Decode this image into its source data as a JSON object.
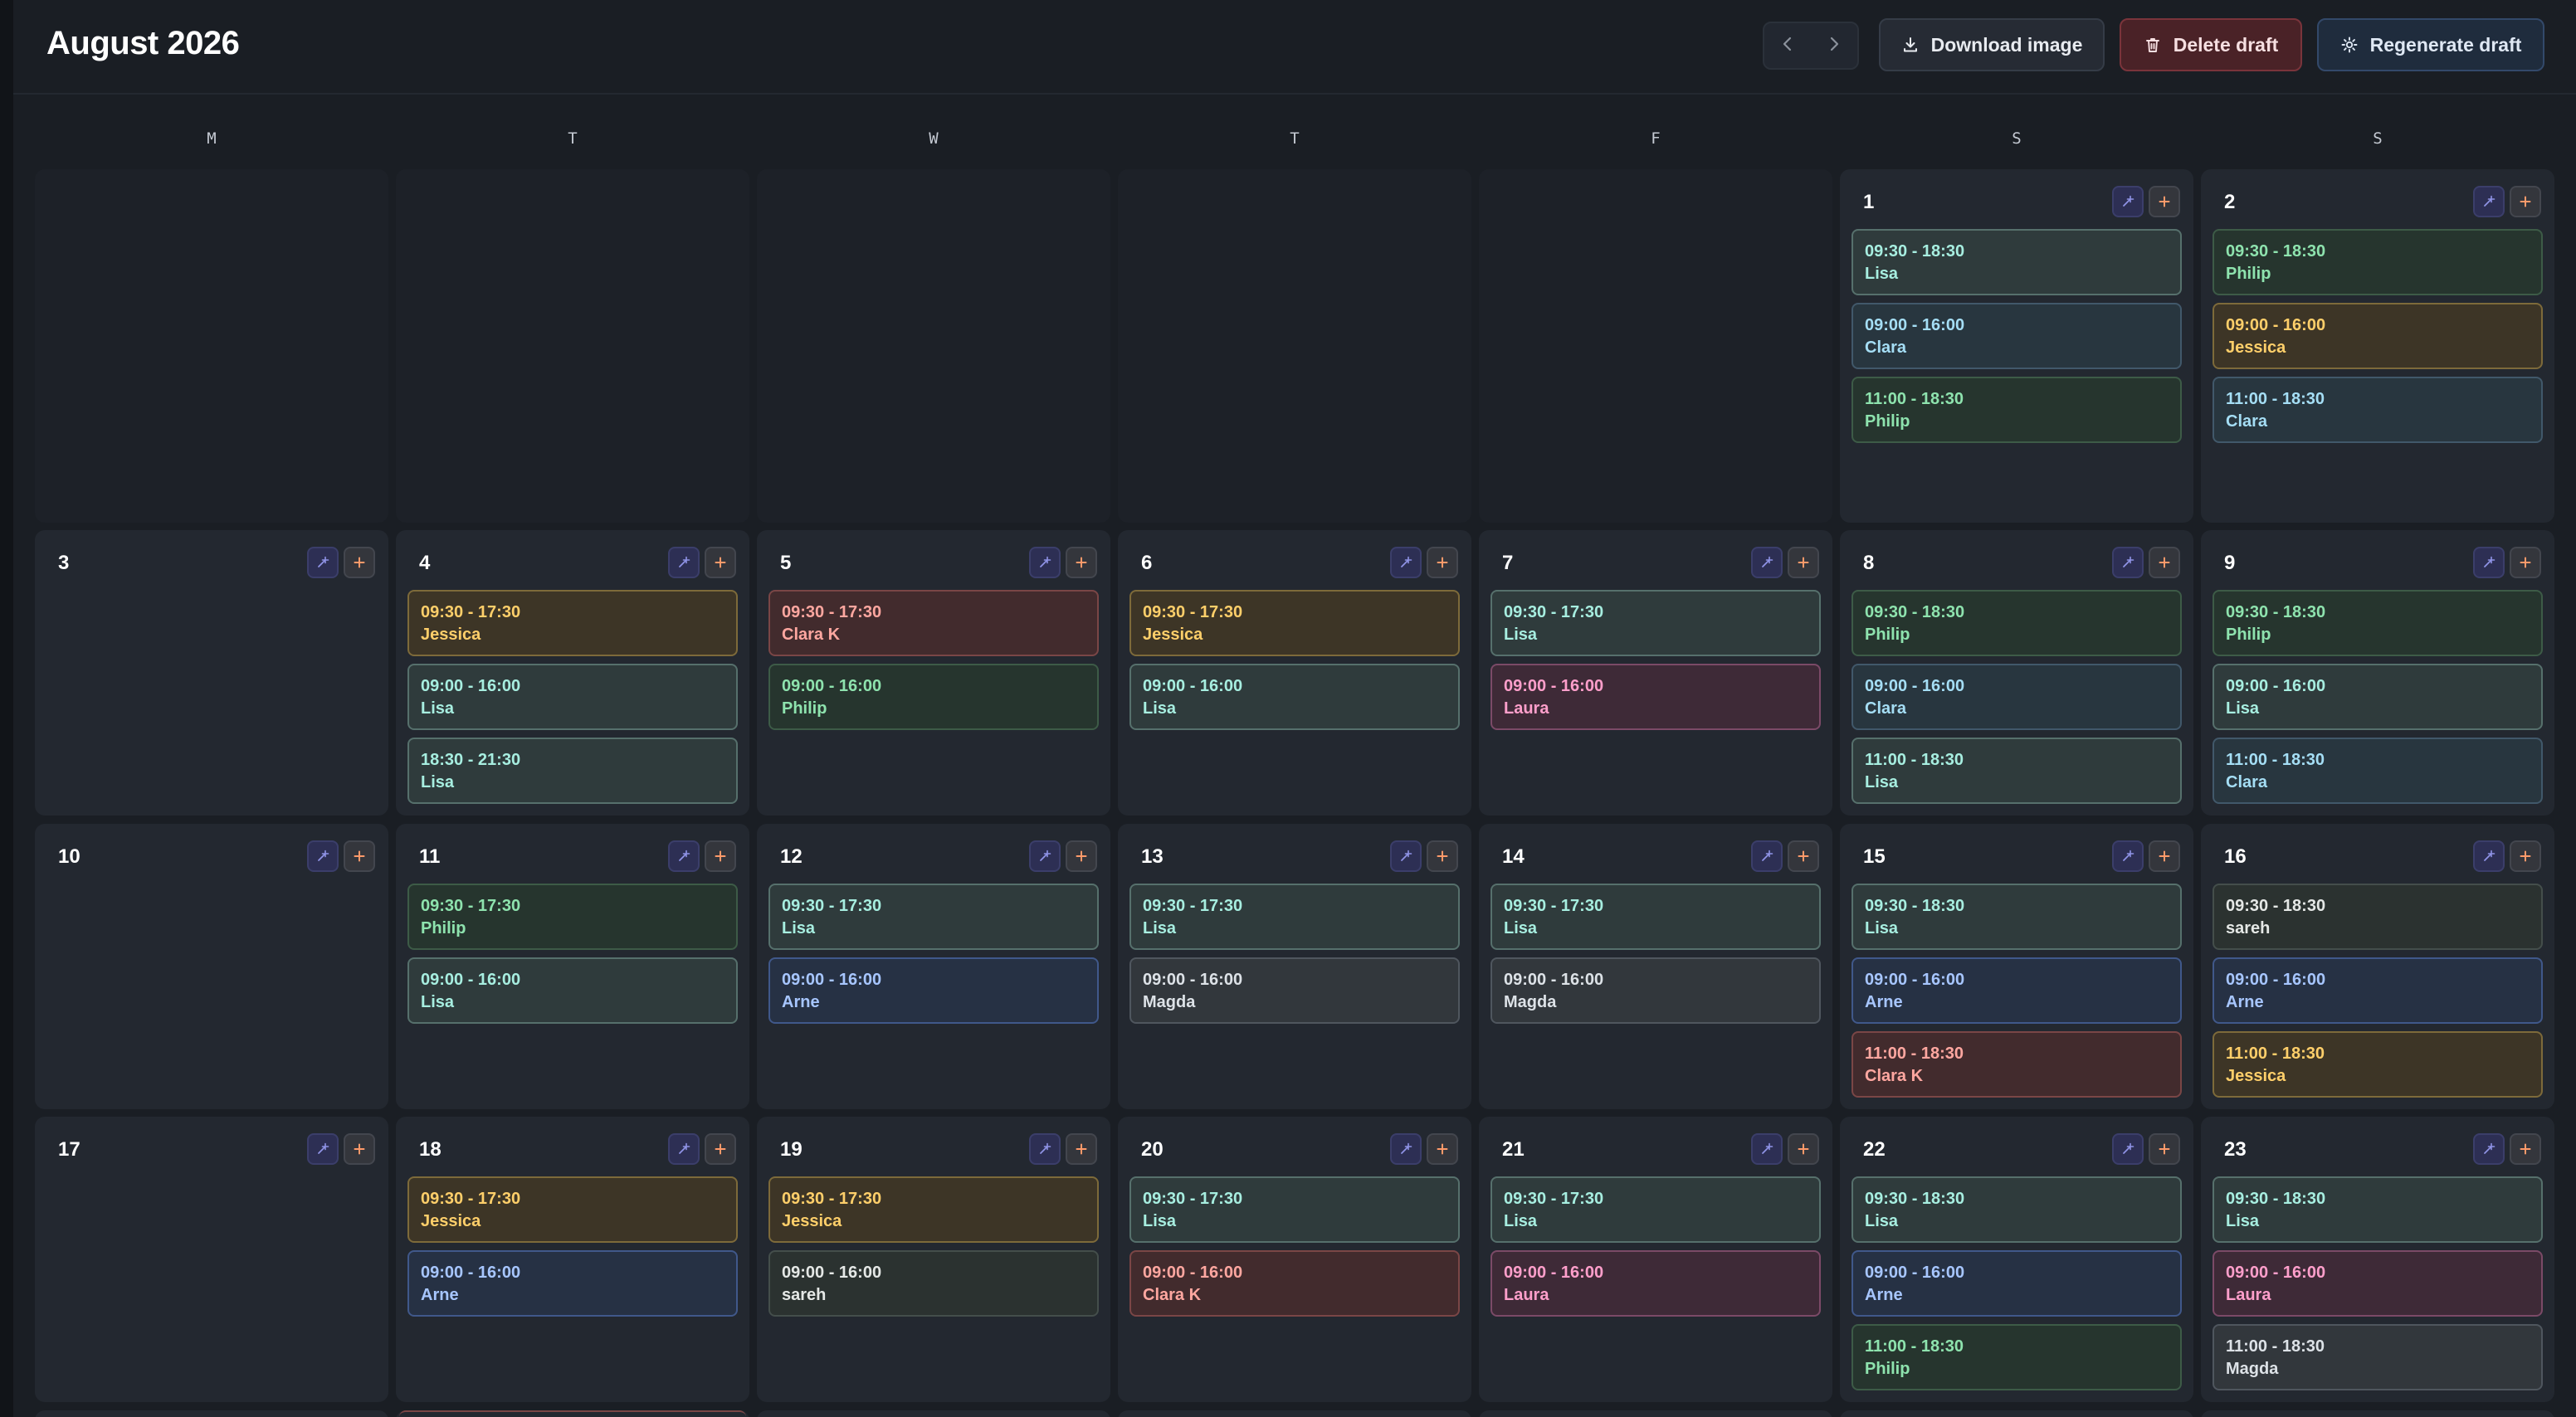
{
  "header": {
    "title": "August 2026",
    "download_label": "Download image",
    "delete_label": "Delete draft",
    "regenerate_label": "Regenerate draft",
    "icons": {
      "prev": "chevron-left-icon",
      "next": "chevron-right-icon",
      "download": "download-icon",
      "delete": "trash-icon",
      "regenerate": "sparkle-icon"
    }
  },
  "weekdays": [
    "M",
    "T",
    "W",
    "T",
    "F",
    "S",
    "S"
  ],
  "cell_icons": {
    "auto_fill": "wand-icon",
    "add": "plus-icon"
  },
  "colors": {
    "lisa": {
      "bg": "#2f3b3c",
      "border": "#56706c",
      "text": "#a7eee0",
      "name": "#a7eee0"
    },
    "clara": {
      "bg": "#28363f",
      "border": "#41586a",
      "text": "#a5def5",
      "name": "#a5def5"
    },
    "philip": {
      "bg": "#26352e",
      "border": "#3d5b47",
      "text": "#8ee3ae",
      "name": "#8ee3ae"
    },
    "jessica": {
      "bg": "#3d3526",
      "border": "#7d6a3a",
      "text": "#ffcf6a",
      "name": "#ffcf6a"
    },
    "clarak": {
      "bg": "#422b2d",
      "border": "#7a4646",
      "text": "#ffa7a0",
      "name": "#ffa7a0"
    },
    "laura": {
      "bg": "#3e2a37",
      "border": "#7b4a67",
      "text": "#ff9fcb",
      "name": "#ff9fcb"
    },
    "arne": {
      "bg": "#263144",
      "border": "#40588a",
      "text": "#a7c6ff",
      "name": "#a7c6ff"
    },
    "magda": {
      "bg": "#32373c",
      "border": "#4f565e",
      "text": "#dde2e7",
      "name": "#dde2e7"
    },
    "sareh": {
      "bg": "#2b3230",
      "border": "#444e4b",
      "text": "#e5e8e6",
      "name": "#e5e8e6"
    }
  },
  "days": [
    {
      "num": "1",
      "row": 0,
      "col": 5,
      "shifts": [
        {
          "time": "09:30 - 18:30",
          "name": "Lisa",
          "color": "lisa"
        },
        {
          "time": "09:00 - 16:00",
          "name": "Clara",
          "color": "clara"
        },
        {
          "time": "11:00 - 18:30",
          "name": "Philip",
          "color": "philip"
        }
      ]
    },
    {
      "num": "2",
      "row": 0,
      "col": 6,
      "shifts": [
        {
          "time": "09:30 - 18:30",
          "name": "Philip",
          "color": "philip"
        },
        {
          "time": "09:00 - 16:00",
          "name": "Jessica",
          "color": "jessica"
        },
        {
          "time": "11:00 - 18:30",
          "name": "Clara",
          "color": "clara"
        }
      ]
    },
    {
      "num": "3",
      "row": 1,
      "col": 0,
      "shifts": []
    },
    {
      "num": "4",
      "row": 1,
      "col": 1,
      "shifts": [
        {
          "time": "09:30 - 17:30",
          "name": "Jessica",
          "color": "jessica"
        },
        {
          "time": "09:00 - 16:00",
          "name": "Lisa",
          "color": "lisa"
        },
        {
          "time": "18:30 - 21:30",
          "name": "Lisa",
          "color": "lisa"
        }
      ]
    },
    {
      "num": "5",
      "row": 1,
      "col": 2,
      "shifts": [
        {
          "time": "09:30 - 17:30",
          "name": "Clara K",
          "color": "clarak"
        },
        {
          "time": "09:00 - 16:00",
          "name": "Philip",
          "color": "philip"
        }
      ]
    },
    {
      "num": "6",
      "row": 1,
      "col": 3,
      "shifts": [
        {
          "time": "09:30 - 17:30",
          "name": "Jessica",
          "color": "jessica"
        },
        {
          "time": "09:00 - 16:00",
          "name": "Lisa",
          "color": "lisa"
        }
      ]
    },
    {
      "num": "7",
      "row": 1,
      "col": 4,
      "shifts": [
        {
          "time": "09:30 - 17:30",
          "name": "Lisa",
          "color": "lisa"
        },
        {
          "time": "09:00 - 16:00",
          "name": "Laura",
          "color": "laura"
        }
      ]
    },
    {
      "num": "8",
      "row": 1,
      "col": 5,
      "shifts": [
        {
          "time": "09:30 - 18:30",
          "name": "Philip",
          "color": "philip"
        },
        {
          "time": "09:00 - 16:00",
          "name": "Clara",
          "color": "clara"
        },
        {
          "time": "11:00 - 18:30",
          "name": "Lisa",
          "color": "lisa"
        }
      ]
    },
    {
      "num": "9",
      "row": 1,
      "col": 6,
      "shifts": [
        {
          "time": "09:30 - 18:30",
          "name": "Philip",
          "color": "philip"
        },
        {
          "time": "09:00 - 16:00",
          "name": "Lisa",
          "color": "lisa"
        },
        {
          "time": "11:00 - 18:30",
          "name": "Clara",
          "color": "clara"
        }
      ]
    },
    {
      "num": "10",
      "row": 2,
      "col": 0,
      "shifts": []
    },
    {
      "num": "11",
      "row": 2,
      "col": 1,
      "shifts": [
        {
          "time": "09:30 - 17:30",
          "name": "Philip",
          "color": "philip"
        },
        {
          "time": "09:00 - 16:00",
          "name": "Lisa",
          "color": "lisa"
        }
      ]
    },
    {
      "num": "12",
      "row": 2,
      "col": 2,
      "shifts": [
        {
          "time": "09:30 - 17:30",
          "name": "Lisa",
          "color": "lisa"
        },
        {
          "time": "09:00 - 16:00",
          "name": "Arne",
          "color": "arne"
        }
      ]
    },
    {
      "num": "13",
      "row": 2,
      "col": 3,
      "shifts": [
        {
          "time": "09:30 - 17:30",
          "name": "Lisa",
          "color": "lisa"
        },
        {
          "time": "09:00 - 16:00",
          "name": "Magda",
          "color": "magda"
        }
      ]
    },
    {
      "num": "14",
      "row": 2,
      "col": 4,
      "shifts": [
        {
          "time": "09:30 - 17:30",
          "name": "Lisa",
          "color": "lisa"
        },
        {
          "time": "09:00 - 16:00",
          "name": "Magda",
          "color": "magda"
        }
      ]
    },
    {
      "num": "15",
      "row": 2,
      "col": 5,
      "shifts": [
        {
          "time": "09:30 - 18:30",
          "name": "Lisa",
          "color": "lisa"
        },
        {
          "time": "09:00 - 16:00",
          "name": "Arne",
          "color": "arne"
        },
        {
          "time": "11:00 - 18:30",
          "name": "Clara K",
          "color": "clarak"
        }
      ]
    },
    {
      "num": "16",
      "row": 2,
      "col": 6,
      "shifts": [
        {
          "time": "09:30 - 18:30",
          "name": "sareh",
          "color": "sareh"
        },
        {
          "time": "09:00 - 16:00",
          "name": "Arne",
          "color": "arne"
        },
        {
          "time": "11:00 - 18:30",
          "name": "Jessica",
          "color": "jessica"
        }
      ]
    },
    {
      "num": "17",
      "row": 3,
      "col": 0,
      "shifts": []
    },
    {
      "num": "18",
      "row": 3,
      "col": 1,
      "shifts": [
        {
          "time": "09:30 - 17:30",
          "name": "Jessica",
          "color": "jessica"
        },
        {
          "time": "09:00 - 16:00",
          "name": "Arne",
          "color": "arne"
        }
      ]
    },
    {
      "num": "19",
      "row": 3,
      "col": 2,
      "shifts": [
        {
          "time": "09:30 - 17:30",
          "name": "Jessica",
          "color": "jessica"
        },
        {
          "time": "09:00 - 16:00",
          "name": "sareh",
          "color": "sareh"
        }
      ]
    },
    {
      "num": "20",
      "row": 3,
      "col": 3,
      "shifts": [
        {
          "time": "09:30 - 17:30",
          "name": "Lisa",
          "color": "lisa"
        },
        {
          "time": "09:00 - 16:00",
          "name": "Clara K",
          "color": "clarak"
        }
      ]
    },
    {
      "num": "21",
      "row": 3,
      "col": 4,
      "shifts": [
        {
          "time": "09:30 - 17:30",
          "name": "Lisa",
          "color": "lisa"
        },
        {
          "time": "09:00 - 16:00",
          "name": "Laura",
          "color": "laura"
        }
      ]
    },
    {
      "num": "22",
      "row": 3,
      "col": 5,
      "shifts": [
        {
          "time": "09:30 - 18:30",
          "name": "Lisa",
          "color": "lisa"
        },
        {
          "time": "09:00 - 16:00",
          "name": "Arne",
          "color": "arne"
        },
        {
          "time": "11:00 - 18:30",
          "name": "Philip",
          "color": "philip"
        }
      ]
    },
    {
      "num": "23",
      "row": 3,
      "col": 6,
      "shifts": [
        {
          "time": "09:30 - 18:30",
          "name": "Lisa",
          "color": "lisa"
        },
        {
          "time": "09:00 - 16:00",
          "name": "Laura",
          "color": "laura"
        },
        {
          "time": "11:00 - 18:30",
          "name": "Magda",
          "color": "magda"
        }
      ]
    }
  ]
}
